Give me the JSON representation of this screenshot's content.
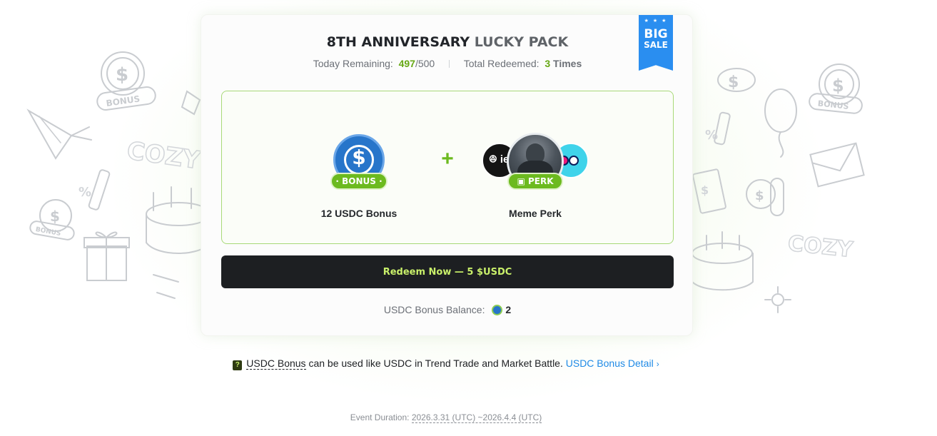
{
  "ribbon": {
    "stars": "★ ★ ★",
    "big": "BIG",
    "sale": "SALE"
  },
  "header": {
    "title_main": "8TH ANNIVERSARY",
    "title_accent": "LUCKY PACK"
  },
  "stats": {
    "remaining_label": "Today Remaining:",
    "remaining_value": "497",
    "remaining_total": "/500",
    "redeemed_label": "Total Redeemed:",
    "redeemed_value": "3",
    "redeemed_unit": "Times"
  },
  "rewards": [
    {
      "label": "12 USDC Bonus",
      "badge": "· BONUS ·",
      "icon": "usdc-coin-icon"
    },
    {
      "label": "Meme Perk",
      "badge": "PERK",
      "icon": "gift-icon",
      "avatar_left_text": "ꔮ ie"
    }
  ],
  "plus_symbol": "+",
  "redeem_button": {
    "label": "Redeem Now — 5 $USDC"
  },
  "balance": {
    "label": "USDC Bonus Balance:",
    "value": "2",
    "icon": "usdc-bonus-coin-icon"
  },
  "note": {
    "icon": "?",
    "term": "USDC Bonus",
    "text": " can be used like USDC in Trend Trade and Market Battle. ",
    "link": "USDC Bonus Detail",
    "chevron": "›"
  },
  "duration": {
    "label": "Event Duration: ",
    "dates": "2026.3.31 (UTC) ~2026.4.4 (UTC)"
  },
  "decor_text": {
    "bonus_1": "BONUS",
    "bonus_2": "BONUS",
    "bonus_3": "BONUS",
    "cozy_1": "COZY",
    "cozy_2": "COZY"
  },
  "colors": {
    "accent_green": "#6cba1f",
    "button_bg": "#1d1f22",
    "button_text": "#c9f06a",
    "link_blue": "#1f8ae6",
    "ribbon_blue": "#2a8ef0",
    "usdc_blue": "#2775ca"
  }
}
